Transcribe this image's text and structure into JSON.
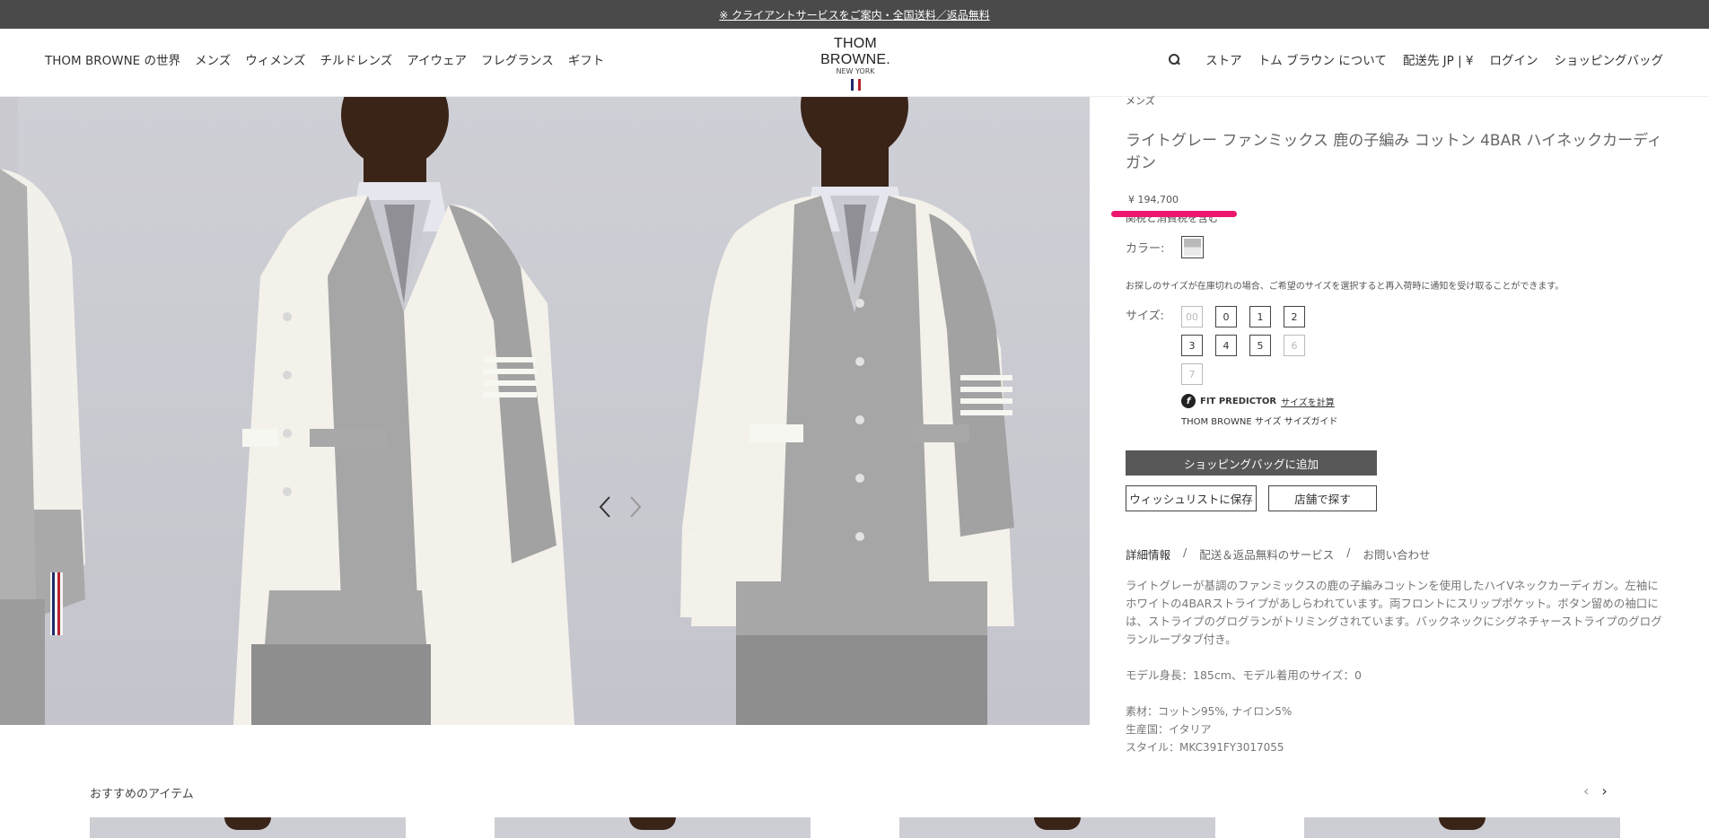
{
  "announcement": "※ クライアントサービスをご案内・全国送料／返品無料",
  "nav_left": [
    "THOM BROWNE の世界",
    "メンズ",
    "ウィメンズ",
    "チルドレンズ",
    "アイウェア",
    "フレグランス",
    "ギフト"
  ],
  "logo": {
    "name": "THOM BROWNE.",
    "sub": "NEW YORK"
  },
  "nav_right": [
    "ストア",
    "トム ブラウン について",
    "配送先 JP | ¥",
    "ログイン",
    "ショッピングバッグ"
  ],
  "product": {
    "breadcrumb": "メンズ",
    "title": "ライトグレー ファンミックス 鹿の子編み コットン 4BAR ハイネックカーディガン",
    "price": "¥ 194,700",
    "tax_note": "関税と消費税を含む",
    "color_label": "カラー:",
    "notice": "お探しのサイズが在庫切れの場合、ご希望のサイズを選択すると再入荷時に通知を受け取ることができます。",
    "size_label": "サイズ:",
    "sizes": [
      {
        "label": "00",
        "available": false
      },
      {
        "label": "0",
        "available": true
      },
      {
        "label": "1",
        "available": true
      },
      {
        "label": "2",
        "available": true
      },
      {
        "label": "3",
        "available": true
      },
      {
        "label": "4",
        "available": true
      },
      {
        "label": "5",
        "available": true
      },
      {
        "label": "6",
        "available": false
      },
      {
        "label": "7",
        "available": false
      }
    ],
    "fit_predictor": "FIT PREDICTOR",
    "fit_calc": "サイズを計算",
    "size_guide": "THOM BROWNE サイズ サイズガイド",
    "add_to_bag": "ショッピングバッグに追加",
    "wishlist": "ウィッシュリストに保存",
    "find_store": "店舗で探す",
    "tabs": [
      "詳細情報",
      "/",
      "配送＆返品無料のサービス",
      "/",
      "お問い合わせ"
    ],
    "description": "ライトグレーが基調のファンミックスの鹿の子編みコットンを使用したハイVネックカーディガン。左袖にホワイトの4BARストライプがあしらわれています。両フロントにスリップポケット。ボタン留めの袖口には、ストライプのグログランがトリミングされています。バックネックにシグネチャーストライプのグログランループタブ付き。",
    "model_info": "モデル身長：185cm、モデル着用のサイズ：0",
    "material": "素材：コットン95%, ナイロン5%",
    "origin": "生産国：イタリア",
    "style": "スタイル：MKC391FY3017055"
  },
  "recommend": {
    "title": "おすすめのアイテム"
  },
  "colors": {
    "announce_bg": "#4a4a4a",
    "button_bg": "#585858",
    "highlight": "#ec1870"
  }
}
